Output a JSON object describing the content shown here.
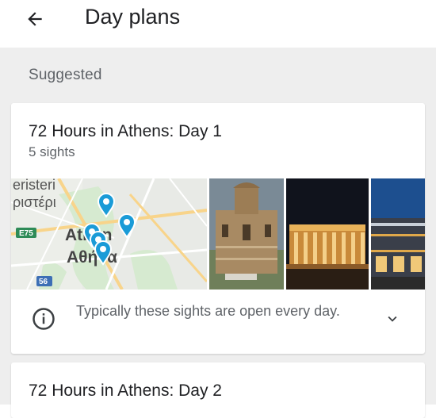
{
  "header": {
    "back_icon": "arrow-left-icon",
    "title": "Day plans"
  },
  "section": {
    "label": "Suggested"
  },
  "cards": [
    {
      "title": "72 Hours in Athens: Day 1",
      "subtitle": "5 sights",
      "map": {
        "labels": [
          "eristeri",
          "ριστέρι",
          "Athen",
          "Αθήνα"
        ],
        "road_shields": [
          "E75",
          "56"
        ],
        "pin_count": 5
      },
      "photos": [
        "church-photo",
        "acropolis-night-photo",
        "museum-photo"
      ],
      "info": {
        "icon": "info-icon",
        "text": "Typically these sights are open every day.",
        "expand_icon": "chevron-down-icon"
      }
    },
    {
      "title": "72 Hours in Athens: Day 2"
    }
  ],
  "colors": {
    "background": "#eeeeee",
    "card": "#ffffff",
    "pin": "#1a9bd7",
    "secondary_text": "#5f6368"
  }
}
